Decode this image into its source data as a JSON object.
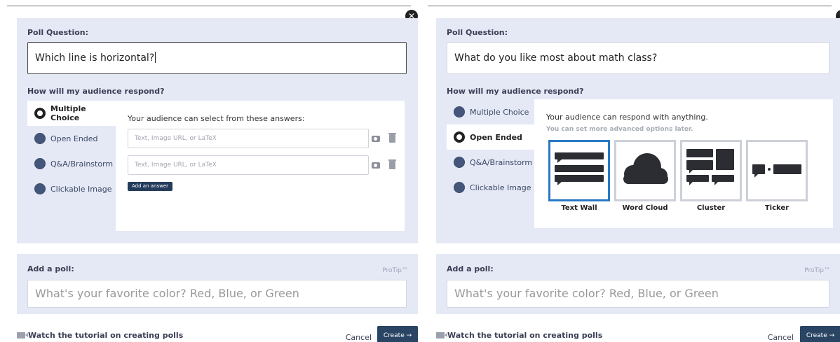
{
  "common": {
    "close_glyph": "✕",
    "poll_question_label": "Poll Question:",
    "respond_label": "How will my audience respond?",
    "tabs": {
      "multiple_choice": "Multiple Choice",
      "open_ended": "Open Ended",
      "qa_brainstorm": "Q&A/Brainstorm",
      "clickable_image": "Clickable Image"
    },
    "add_poll_label": "Add a poll:",
    "protip": "ProTip™",
    "add_poll_placeholder": "What's your favorite color? Red, Blue, or Green",
    "tutorial_link": "Watch the tutorial on creating polls",
    "cancel": "Cancel",
    "create": "Create →"
  },
  "left": {
    "question_value": "Which line is horizontal?",
    "active_tab": "Multiple Choice",
    "content_title": "Your audience can select from these answers:",
    "answer_placeholder": "Text, Image URL, or LaTeX",
    "add_answer": "Add an answer"
  },
  "right": {
    "question_value": "What do you like most about math class?",
    "active_tab": "Open Ended",
    "content_title": "Your audience can respond with anything.",
    "content_sub": "You can set more advanced options later.",
    "viz_options": [
      "Text Wall",
      "Word Cloud",
      "Cluster",
      "Ticker"
    ],
    "selected_viz": "Text Wall"
  },
  "colors": {
    "section_bg": "#e5e8f5",
    "create_bg": "#2a4564",
    "selected_border": "#2979c4"
  }
}
